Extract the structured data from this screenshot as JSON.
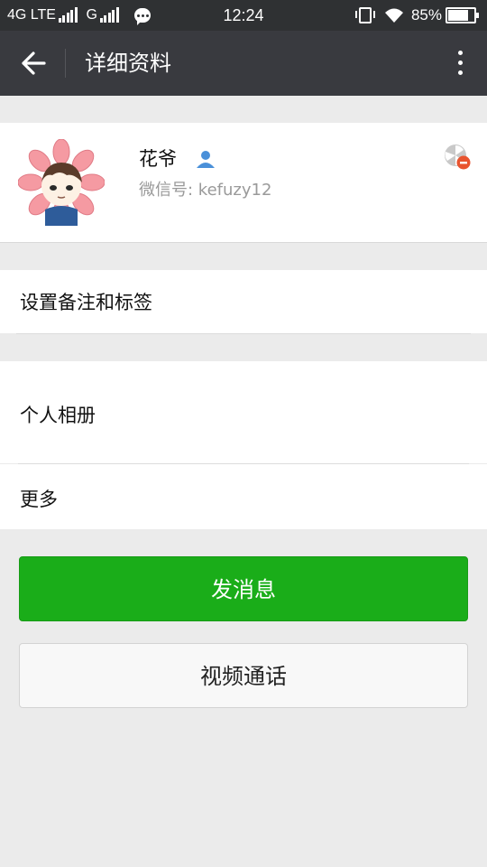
{
  "status_bar": {
    "network1": "4G LTE",
    "network2": "G",
    "time": "12:24",
    "battery": "85%",
    "battery_level": 0.85,
    "icons": [
      "signal-icon",
      "chat-notification-icon",
      "vibrate-icon",
      "wifi-icon",
      "battery-icon"
    ]
  },
  "header": {
    "title": "详细资料",
    "back_icon": "back-arrow-icon",
    "more_icon": "more-vertical-icon"
  },
  "profile": {
    "nickname": "花爷",
    "wechat_id": "微信号: kefuzy12",
    "contact_icon": "contact-person-icon",
    "moments_icon": "moments-blocked-icon"
  },
  "menu": {
    "remark_tags": "设置备注和标签",
    "personal_album": "个人相册",
    "more": "更多"
  },
  "actions": {
    "send_message": "发消息",
    "video_call": "视频通话"
  },
  "colors": {
    "status_bar": "#2f3133",
    "title_bar": "#393a3f",
    "primary_green": "#1aad19",
    "background": "#ebebeb"
  }
}
